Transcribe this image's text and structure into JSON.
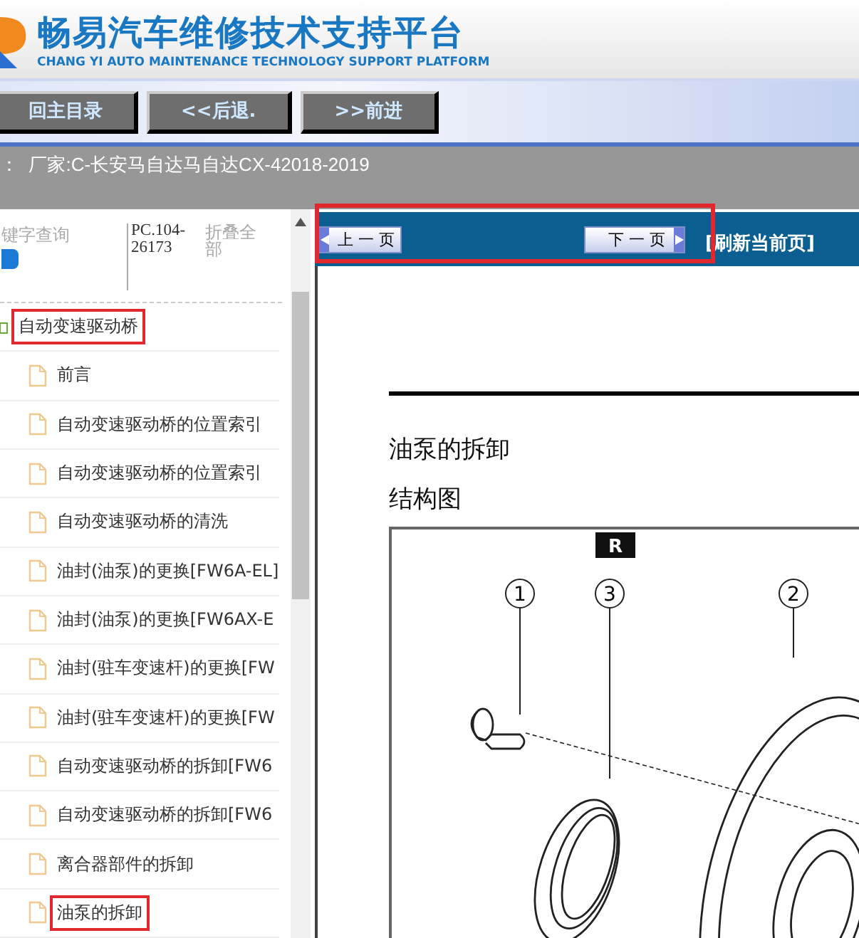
{
  "header": {
    "title": "畅易汽车维修技术支持平台",
    "subtitle": "CHANG YI AUTO MAINTENANCE TECHNOLOGY SUPPORT PLATFORM"
  },
  "toolbar": {
    "buttons": [
      "回主目录",
      "<<后退.",
      ">>前进"
    ]
  },
  "breadcrumb": "：  厂家:C-长安马自达马自达CX-42018-2019",
  "sidebar": {
    "search_label": "键字查询",
    "code": "PC.104-26173",
    "collapse_all": "折叠全部",
    "tree": [
      {
        "label": "自动变速驱动桥",
        "highlighted": true,
        "expanded": true,
        "children": [
          {
            "label": "前言",
            "highlighted": false
          },
          {
            "label": "自动变速驱动桥的位置索引",
            "highlighted": false
          },
          {
            "label": "自动变速驱动桥的位置索引",
            "highlighted": false
          },
          {
            "label": "自动变速驱动桥的清洗",
            "highlighted": false
          },
          {
            "label": "油封(油泵)的更换[FW6A-EL]",
            "highlighted": false
          },
          {
            "label": "油封(油泵)的更换[FW6AX-E",
            "highlighted": false
          },
          {
            "label": "油封(驻车变速杆)的更换[FW",
            "highlighted": false
          },
          {
            "label": "油封(驻车变速杆)的更换[FW",
            "highlighted": false
          },
          {
            "label": "自动变速驱动桥的拆卸[FW6",
            "highlighted": false
          },
          {
            "label": "自动变速驱动桥的拆卸[FW6",
            "highlighted": false
          },
          {
            "label": "离合器部件的拆卸",
            "highlighted": false
          },
          {
            "label": "油泵的拆卸",
            "highlighted": true
          }
        ]
      }
    ]
  },
  "content": {
    "nav": {
      "highlighted": true,
      "prev": "上 一 页",
      "next": "下 一 页",
      "refresh": "[刷新当前页]"
    },
    "title": "油泵的拆卸",
    "subtitle": "结构图",
    "figure": {
      "badge": "R",
      "callouts": [
        "1",
        "3",
        "2"
      ]
    }
  }
}
